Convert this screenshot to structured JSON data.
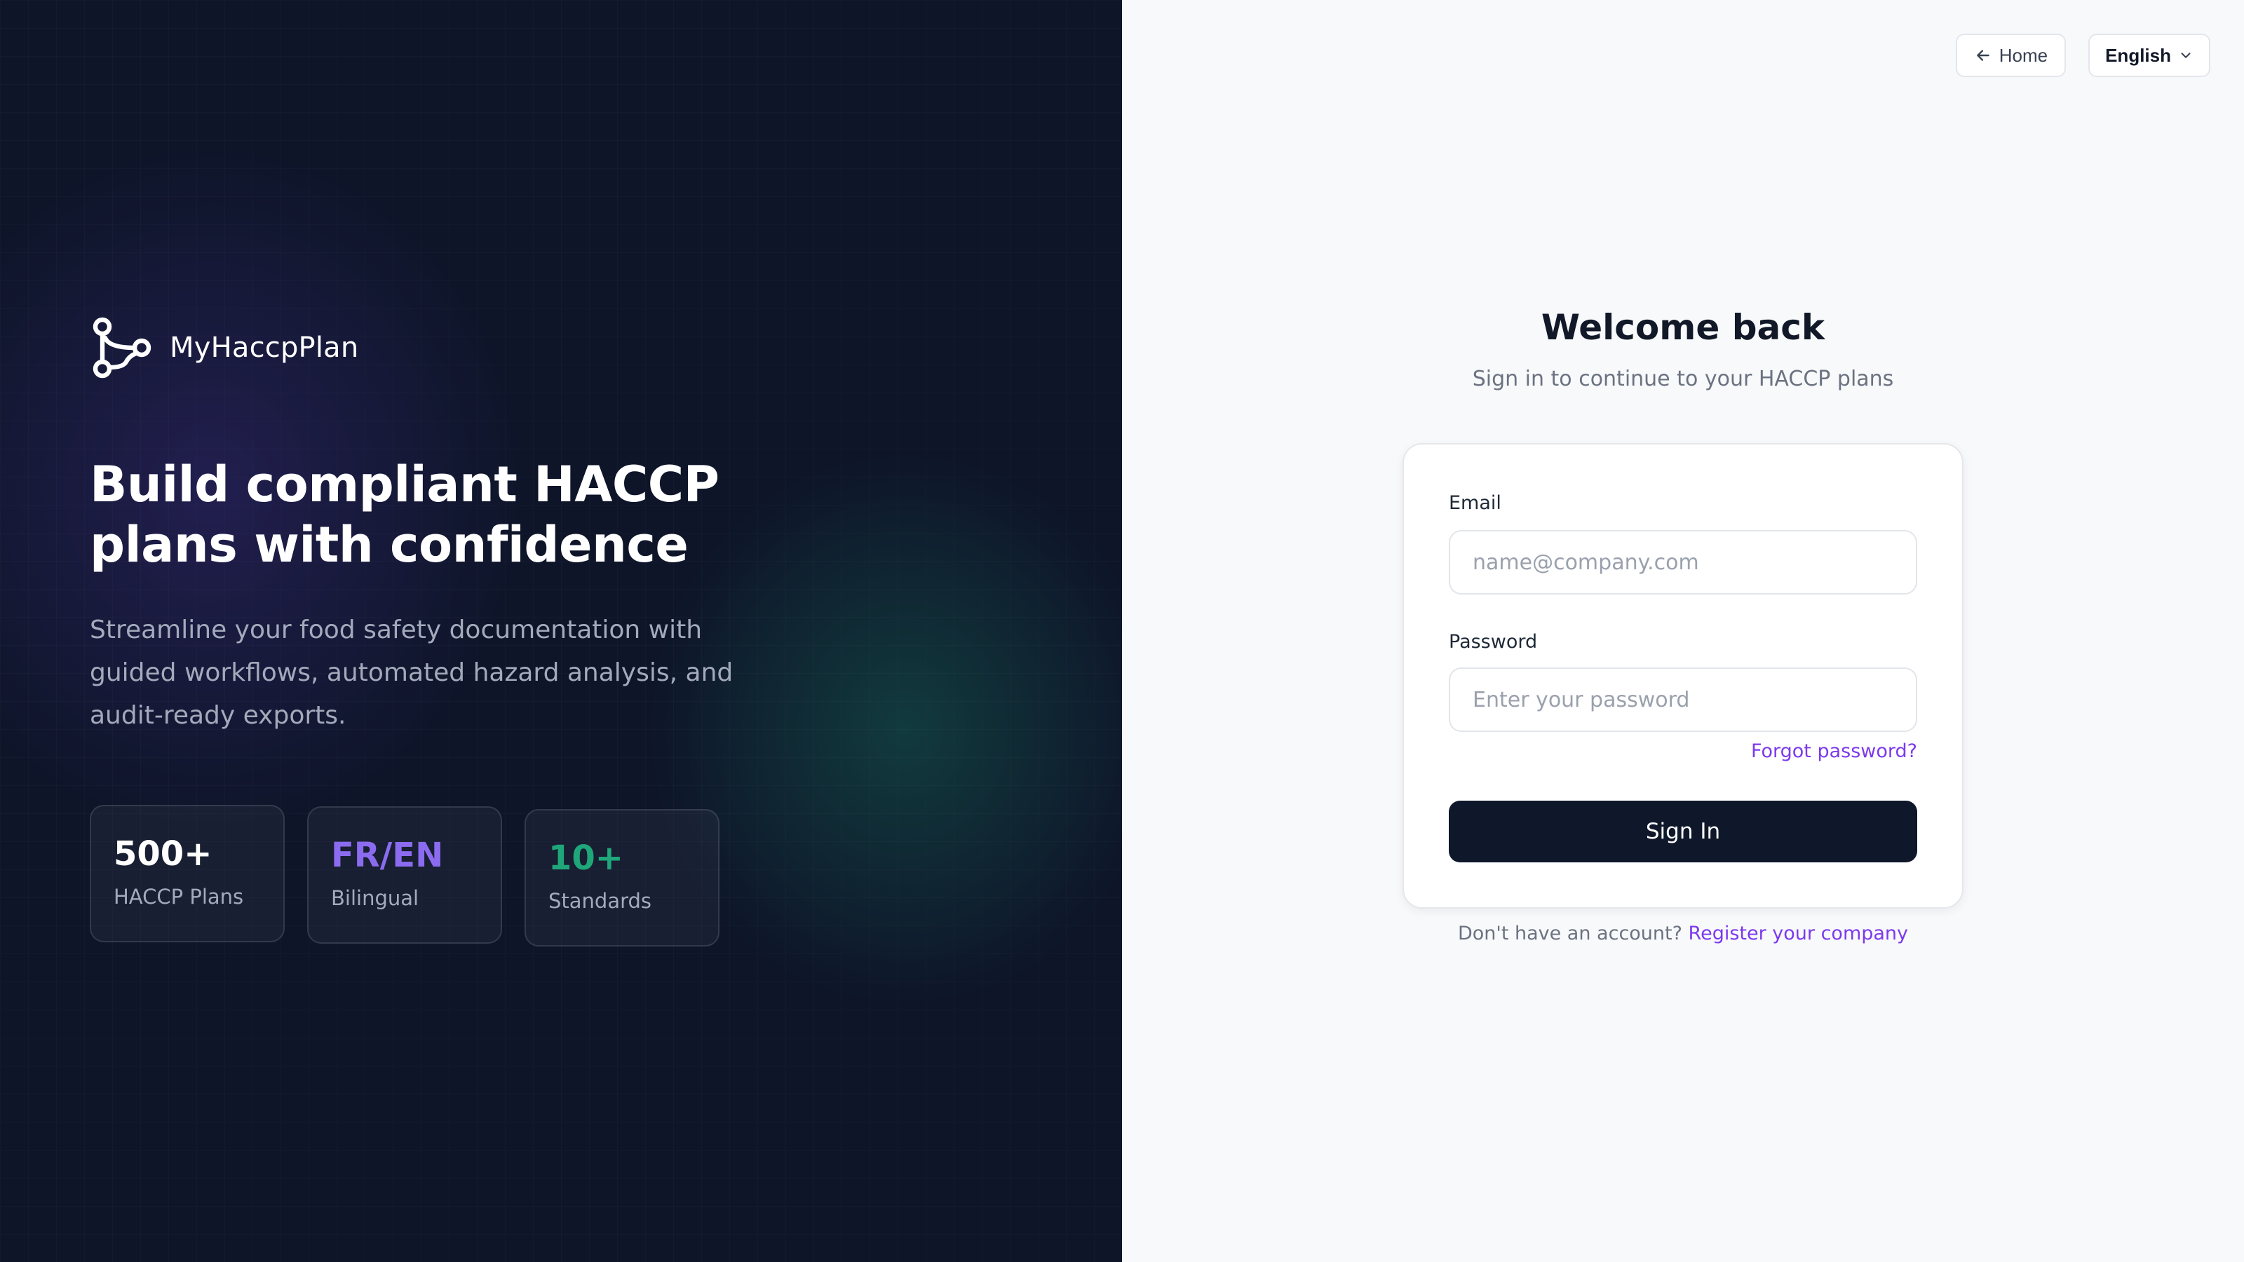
{
  "brand": {
    "name": "MyHaccpPlan",
    "icon": "node-graph-logo-icon"
  },
  "hero": {
    "title": "Build compliant HACCP plans with confidence",
    "subtitle": "Streamline your food safety documentation with guided workflows, automated hazard analysis, and audit-ready exports.",
    "stats": [
      {
        "value": "500+",
        "label": "HACCP Plans",
        "color": "#ffffff"
      },
      {
        "value": "FR/EN",
        "label": "Bilingual",
        "color": "#8b6cf0"
      },
      {
        "value": "10+",
        "label": "Standards",
        "color": "#1fa77a"
      }
    ]
  },
  "nav": {
    "home_label": "Home",
    "home_icon": "arrow-left-icon",
    "language": "English",
    "language_icon": "chevron-down-icon"
  },
  "auth": {
    "title": "Welcome back",
    "subtitle": "Sign in to continue to your HACCP plans",
    "email_label": "Email",
    "email_value": "",
    "email_placeholder": "name@company.com",
    "password_label": "Password",
    "password_value": "",
    "password_placeholder": "Enter your password",
    "forgot_label": "Forgot password?",
    "submit_label": "Sign In",
    "register_prompt": "Don't have an account?",
    "register_link": "Register your company"
  },
  "colors": {
    "hero_bg": "#0e1529",
    "primary_button": "#0f172a",
    "link": "#7c3aed",
    "accent_purple": "#8b6cf0",
    "accent_green": "#1fa77a"
  }
}
